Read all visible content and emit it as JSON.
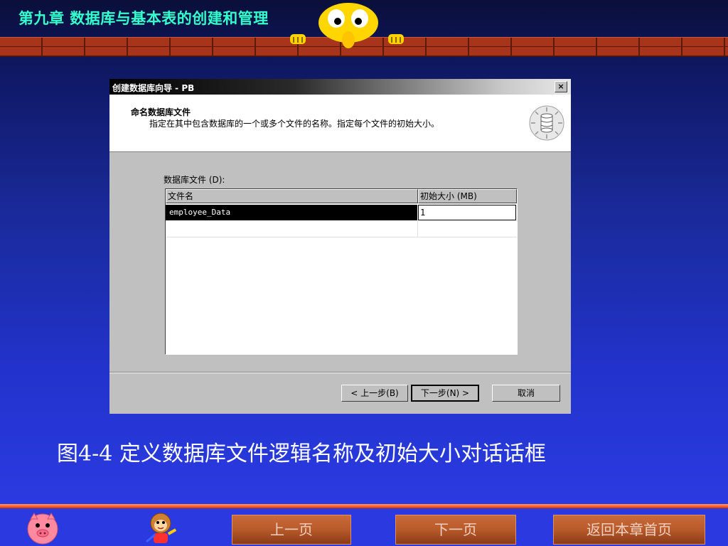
{
  "header": {
    "chapter_title": "第九章   数据库与基本表的创建和管理"
  },
  "dialog": {
    "title": "创建数据库向导 - PB",
    "close_symbol": "×",
    "heading": "命名数据库文件",
    "description": "指定在其中包含数据库的一个或多个文件的名称。指定每个文件的初始大小。",
    "files_label": "数据库文件 (D):",
    "table": {
      "columns": [
        "文件名",
        "初始大小 (MB)"
      ],
      "rows": [
        {
          "name": "employee_Data",
          "size": "1"
        }
      ]
    },
    "buttons": {
      "back": "< 上一步(B)",
      "next": "下一步(N) >",
      "cancel": "取消"
    }
  },
  "caption": "图4-4   定义数据库文件逻辑名称及初始大小对话话框",
  "footer": {
    "prev": "上一页",
    "next": "下一页",
    "home": "返回本章首页"
  }
}
